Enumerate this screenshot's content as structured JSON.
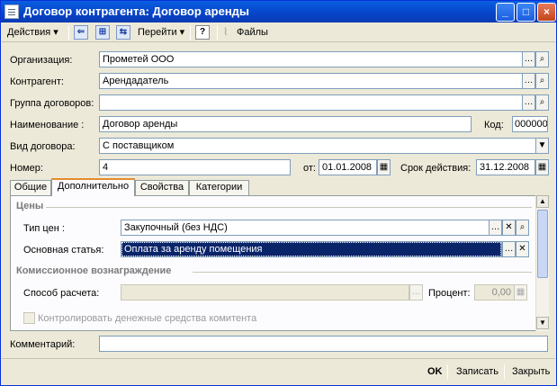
{
  "window": {
    "title": "Договор контрагента: Договор аренды"
  },
  "toolbar": {
    "actions": "Действия",
    "goto": "Перейти",
    "help": "?",
    "files": "Файлы"
  },
  "form": {
    "org_label": "Организация:",
    "org_value": "Прометей ООО",
    "contr_label": "Контрагент:",
    "contr_value": "Арендадатель",
    "group_label": "Группа договоров:",
    "group_value": "",
    "name_label": "Наименование :",
    "name_value": "Договор аренды",
    "code_label": "Код:",
    "code_value": "000000",
    "type_label": "Вид договора:",
    "type_value": "С поставщиком",
    "num_label": "Номер:",
    "num_value": "4",
    "from_label": "от:",
    "from_value": "01.01.2008",
    "valid_label": "Срок действия:",
    "valid_value": "31.12.2008"
  },
  "tabs": [
    "Общие",
    "Дополнительно",
    "Свойства",
    "Категории"
  ],
  "panel": {
    "prices_header": "Цены",
    "price_type_label": "Тип цен :",
    "price_type_value": "Закупочный (без НДС)",
    "main_item_label": "Основная статья:",
    "main_item_value": "Оплата за аренду помещения",
    "commission_header": "Комиссионное вознаграждение",
    "calc_label": "Способ расчета:",
    "calc_value": "",
    "percent_label": "Процент:",
    "percent_value": "0,00",
    "control_label": "Контролировать денежные средства комитента"
  },
  "comment": {
    "label": "Комментарий:",
    "value": ""
  },
  "buttons": {
    "ok": "OK",
    "save": "Записать",
    "close": "Закрыть"
  }
}
